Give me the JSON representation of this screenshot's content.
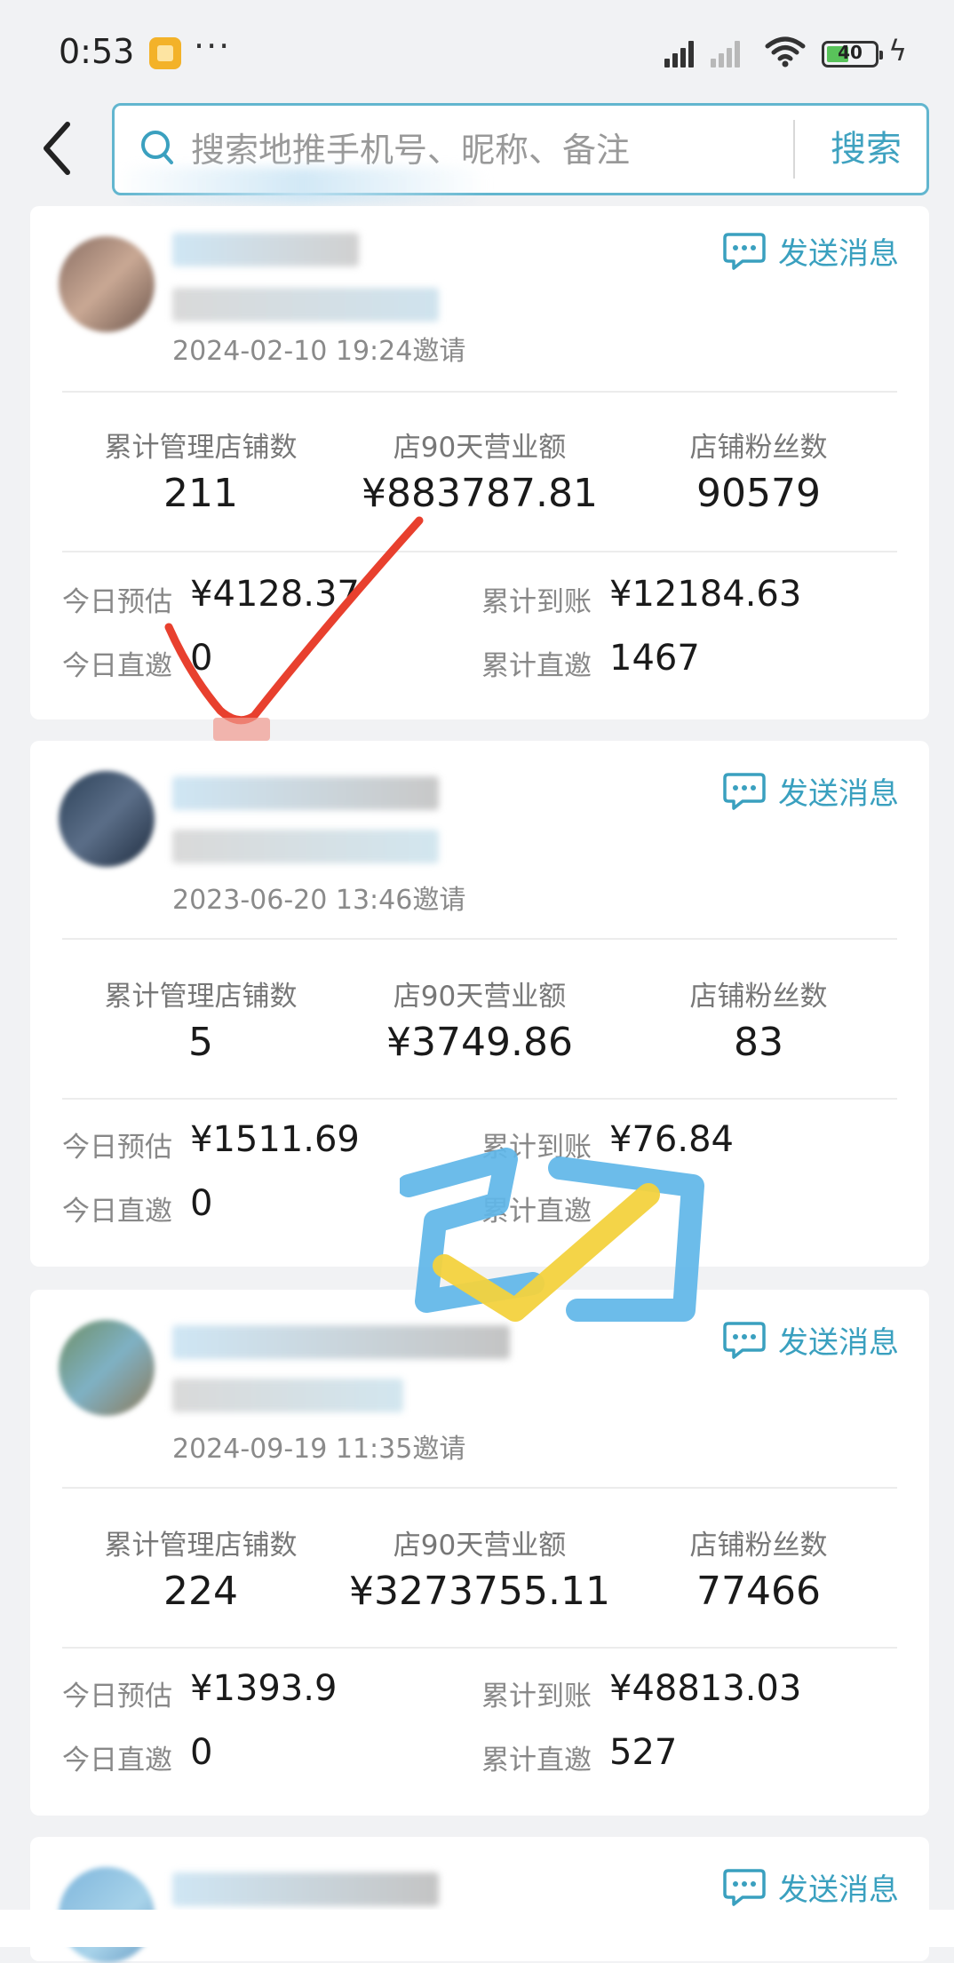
{
  "status_bar": {
    "time": "0:53",
    "more": "···",
    "battery": "40"
  },
  "search": {
    "placeholder": "搜索地推手机号、昵称、备注",
    "button": "搜索"
  },
  "colors": {
    "accent": "#3aa0bf",
    "search_border": "#62b6cf",
    "annotation_red": "#e8402e",
    "stamp_blue": "#5fb6e8",
    "stamp_yellow": "#f3d23e"
  },
  "icons": [
    "back-arrow-icon",
    "search-icon",
    "message-bubble-icon",
    "wifi-icon",
    "battery-icon",
    "signal-icon"
  ],
  "stats_labels": {
    "stores": "累计管理店铺数",
    "revenue": "店90天营业额",
    "fans": "店铺粉丝数",
    "today_est": "今日预估",
    "total_received": "累计到账",
    "today_direct": "今日直邀",
    "total_direct": "累计直邀"
  },
  "send_message_label": "发送消息",
  "cards": [
    {
      "invite_time": "2024-02-10 19:24邀请",
      "stores": "211",
      "revenue": "¥883787.81",
      "fans": "90579",
      "today_est": "¥4128.37",
      "total_received": "¥12184.63",
      "today_direct": "0",
      "total_direct": "1467"
    },
    {
      "invite_time": "2023-06-20 13:46邀请",
      "stores": "5",
      "revenue": "¥3749.86",
      "fans": "83",
      "today_est": "¥1511.69",
      "total_received": "¥76.84",
      "today_direct": "0",
      "total_direct": ""
    },
    {
      "invite_time": "2024-09-19 11:35邀请",
      "stores": "224",
      "revenue": "¥3273755.11",
      "fans": "77466",
      "today_est": "¥1393.9",
      "total_received": "¥48813.03",
      "today_direct": "0",
      "total_direct": "527"
    }
  ]
}
